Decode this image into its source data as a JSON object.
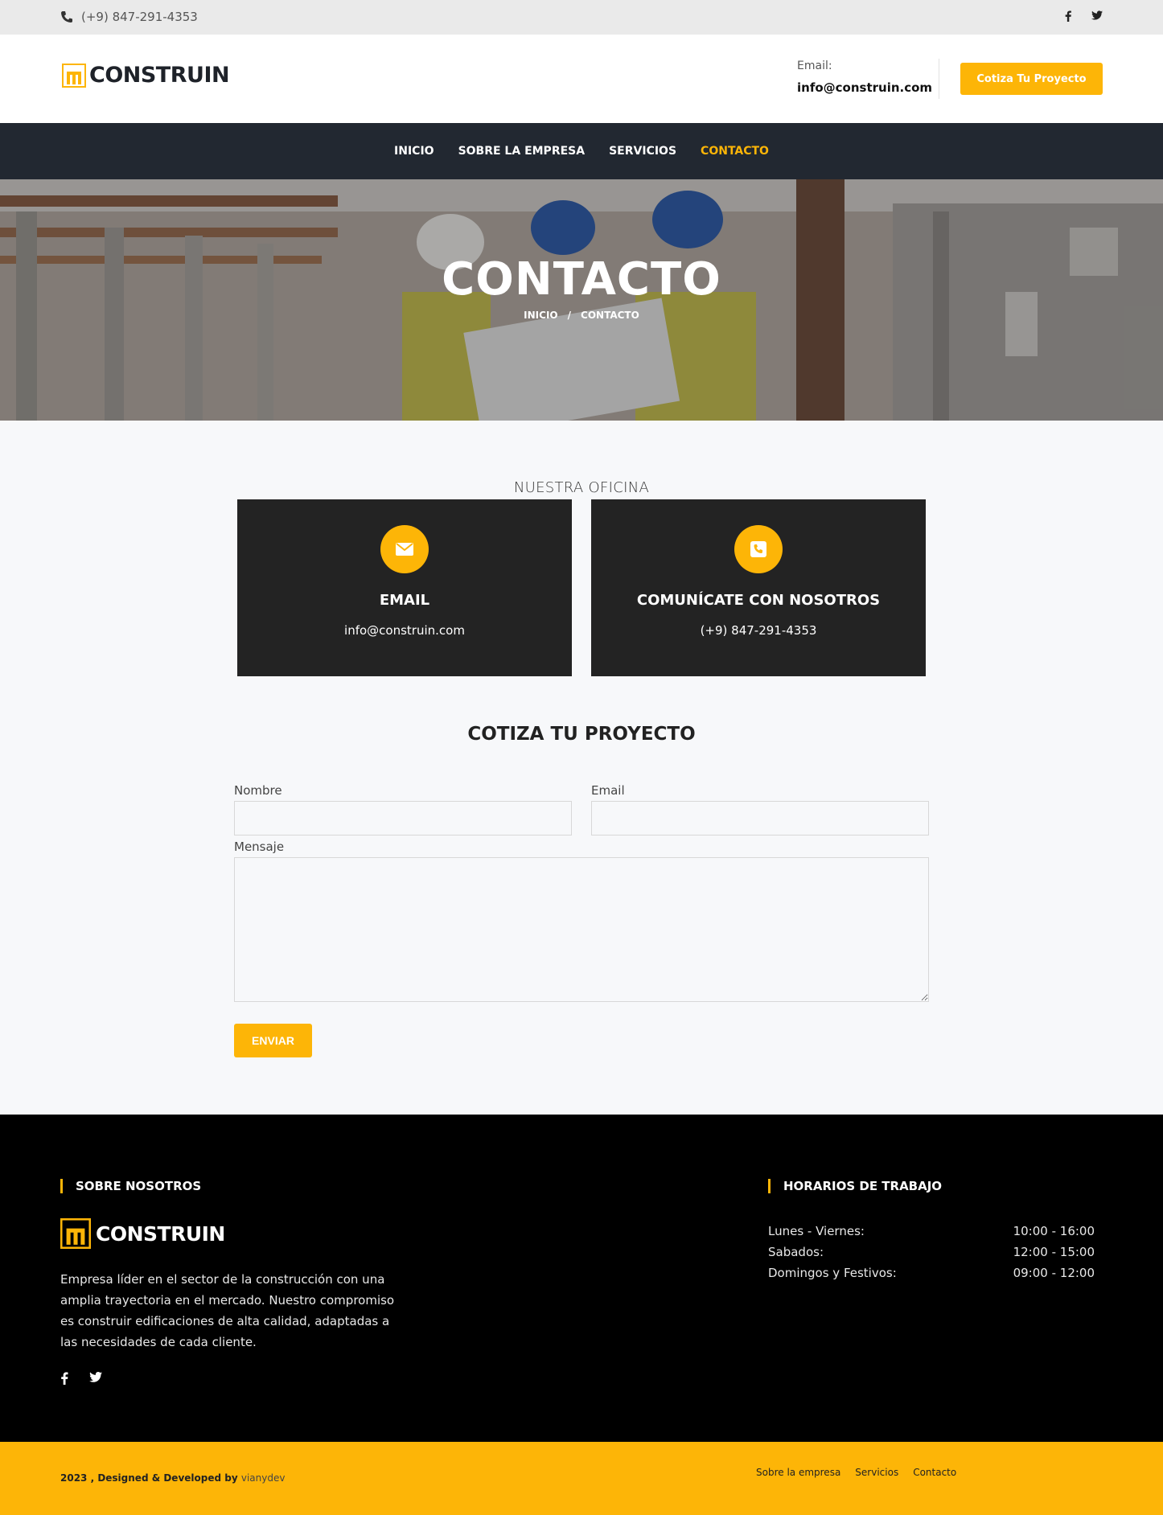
{
  "topbar": {
    "phone": "(+9) 847-291-4353"
  },
  "header": {
    "logo_text": "CONSTRUIN",
    "email_label": "Email:",
    "email_value": "info@construin.com",
    "quote_button": "Cotiza Tu Proyecto"
  },
  "nav": {
    "items": [
      {
        "label": "INICIO"
      },
      {
        "label": "SOBRE LA EMPRESA"
      },
      {
        "label": "SERVICIOS"
      },
      {
        "label": "CONTACTO"
      }
    ]
  },
  "hero": {
    "title": "CONTACTO",
    "crumb_home": "INICIO",
    "crumb_sep": "/",
    "crumb_current": "CONTACTO"
  },
  "office": {
    "title": "NUESTRA OFICINA",
    "cards": [
      {
        "title": "EMAIL",
        "value": "info@construin.com"
      },
      {
        "title": "COMUNÍCATE CON NOSOTROS",
        "value": "(+9) 847-291-4353"
      }
    ]
  },
  "form": {
    "title": "COTIZA TU PROYECTO",
    "name_label": "Nombre",
    "email_label": "Email",
    "message_label": "Mensaje",
    "submit": "ENVIAR"
  },
  "footer": {
    "about_heading": "SOBRE NOSOTROS",
    "logo_text": "CONSTRUIN",
    "description": "Empresa líder en el sector de la construcción con una amplia trayectoria en el mercado. Nuestro compromiso es construir edificaciones de alta calidad, adaptadas a las necesidades de cada cliente.",
    "hours_heading": "HORARIOS DE TRABAJO",
    "hours": [
      {
        "day": "Lunes - Viernes:",
        "time": "10:00 - 16:00"
      },
      {
        "day": "Sabados:",
        "time": "12:00 - 15:00"
      },
      {
        "day": "Domingos y Festivos:",
        "time": "09:00 - 12:00"
      }
    ]
  },
  "bottom": {
    "copyright": "2023 , Designed & Developed by",
    "developer": "vianydev",
    "links": [
      "Sobre la empresa",
      "Servicios",
      "Contacto"
    ]
  },
  "colors": {
    "accent": "#fdb507",
    "nav_bg": "#222831",
    "card_bg": "#232323",
    "footer_bg": "#000000"
  }
}
